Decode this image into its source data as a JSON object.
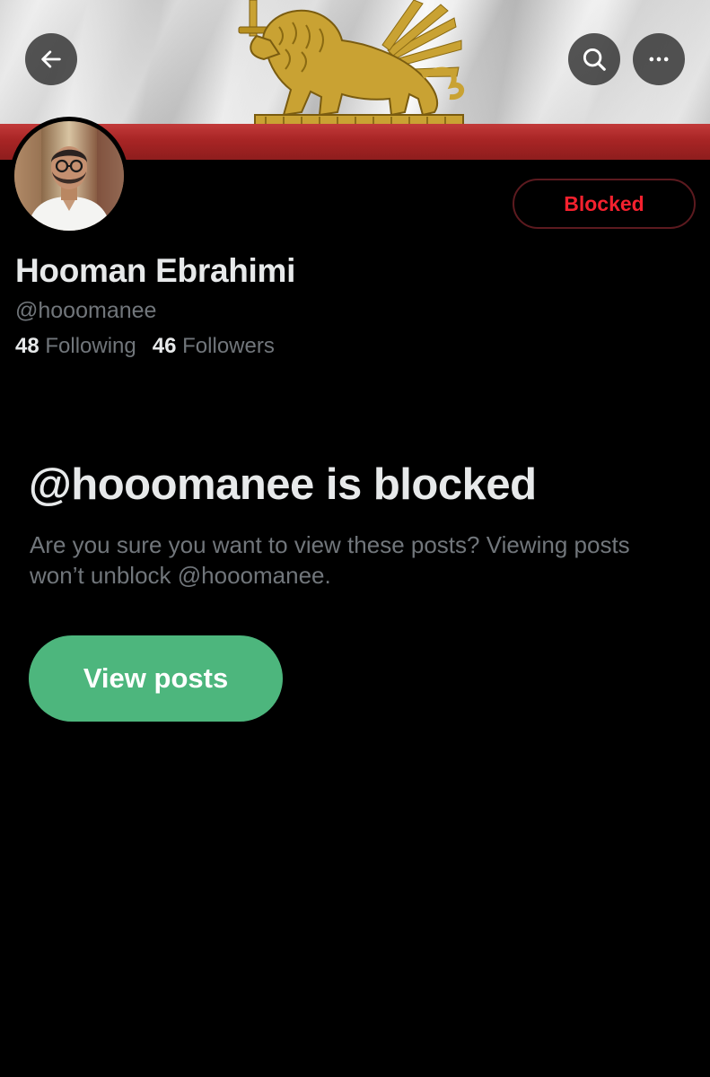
{
  "header": {
    "back_icon": "arrow-left-icon",
    "search_icon": "search-icon",
    "more_icon": "more-horizontal-icon",
    "banner_colors": {
      "red": "#a82525",
      "gold": "#c9a233",
      "white": "#e8e8e8"
    }
  },
  "profile": {
    "display_name": "Hooman Ebrahimi",
    "handle": "@hooomanee",
    "following_count": "48",
    "following_label": "Following",
    "followers_count": "46",
    "followers_label": "Followers",
    "blocked_button_label": "Blocked"
  },
  "blocked_notice": {
    "title": "@hooomanee is blocked",
    "description": "Are you sure you want to view these posts? Viewing posts won’t unblock @hooomanee.",
    "view_posts_label": "View posts"
  },
  "colors": {
    "background": "#000000",
    "primary_text": "#e7e9ea",
    "secondary_text": "#71767b",
    "blocked_red": "#f4212e",
    "view_button_green": "#4db67d"
  }
}
